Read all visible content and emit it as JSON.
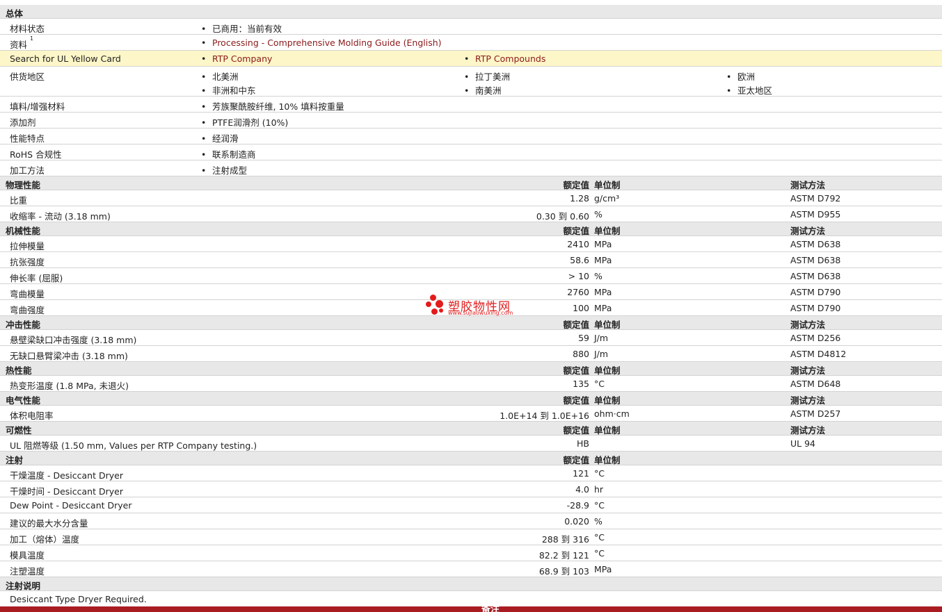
{
  "general": {
    "title": "总体",
    "status_label": "材料状态",
    "status_value": "已商用：当前有效",
    "resources_label": "资料",
    "resources_sup": "1",
    "resources_link": "Processing - Comprehensive Molding Guide (English)",
    "ul_label": "Search for UL Yellow Card",
    "ul_link1": "RTP Company",
    "ul_link2": "RTP Compounds",
    "region_label": "供货地区",
    "regions": [
      "北美洲",
      "拉丁美洲",
      "欧洲",
      "非洲和中东",
      "南美洲",
      "亚太地区"
    ],
    "filler_label": "填料/增强材料",
    "filler_value": "芳族聚酰胺纤维, 10% 填料按重量",
    "additive_label": "添加剂",
    "additive_value": "PTFE润滑剂 (10%)",
    "features_label": "性能特点",
    "features_value": "经润滑",
    "rohs_label": "RoHS 合规性",
    "rohs_value": "联系制造商",
    "process_label": "加工方法",
    "process_value": "注射成型",
    "bullet": "•"
  },
  "col_headers": {
    "value": "额定值",
    "unit": "单位制",
    "test": "测试方法"
  },
  "physical": {
    "title": "物理性能",
    "rows": [
      {
        "label": "比重",
        "value": "1.28",
        "unit": "g/cm³",
        "test": "ASTM D792"
      },
      {
        "label": "收缩率  - 流动  (3.18 mm)",
        "value": "0.30 到  0.60",
        "unit": "%",
        "test": "ASTM D955"
      }
    ]
  },
  "mechanical": {
    "title": "机械性能",
    "rows": [
      {
        "label": "拉伸模量",
        "value": "2410",
        "unit": "MPa",
        "test": "ASTM D638"
      },
      {
        "label": "抗张强度",
        "value": "58.6",
        "unit": "MPa",
        "test": "ASTM D638"
      },
      {
        "label": "伸长率  (屈服)",
        "value": "> 10",
        "unit": "%",
        "test": "ASTM D638"
      },
      {
        "label": "弯曲模量",
        "value": "2760",
        "unit": "MPa",
        "test": "ASTM D790"
      },
      {
        "label": "弯曲强度",
        "value": "100",
        "unit": "MPa",
        "test": "ASTM D790"
      }
    ]
  },
  "impact": {
    "title": "冲击性能",
    "rows": [
      {
        "label": "悬壁梁缺口冲击强度  (3.18 mm)",
        "value": "59",
        "unit": "J/m",
        "test": "ASTM D256"
      },
      {
        "label": "无缺口悬臂梁冲击  (3.18 mm)",
        "value": "880",
        "unit": "J/m",
        "test": "ASTM D4812"
      }
    ]
  },
  "thermal": {
    "title": "热性能",
    "rows": [
      {
        "label": "热变形温度  (1.8 MPa, 未退火)",
        "value": "135",
        "unit": "°C",
        "test": "ASTM D648"
      }
    ]
  },
  "electrical": {
    "title": "电气性能",
    "rows": [
      {
        "label": "体积电阻率",
        "value": "1.0E+14 到  1.0E+16",
        "unit": "ohm·cm",
        "test": "ASTM D257"
      }
    ]
  },
  "flammability": {
    "title": "可燃性",
    "rows": [
      {
        "label": "UL 阻燃等级  (1.50 mm, Values per RTP Company testing.)",
        "value": "HB",
        "unit": "",
        "test": "UL 94"
      }
    ]
  },
  "injection": {
    "title": "注射",
    "rows": [
      {
        "label": "干燥温度  - Desiccant Dryer",
        "value": "121",
        "unit": "°C"
      },
      {
        "label": "干燥时间  - Desiccant Dryer",
        "value": "4.0",
        "unit": "hr"
      },
      {
        "label": "Dew Point - Desiccant Dryer",
        "value": "-28.9",
        "unit": "°C"
      },
      {
        "label": "建议的最大水分含量",
        "value": "0.020",
        "unit": "%"
      },
      {
        "label": "加工（熔体）温度",
        "value": "288 到  316",
        "unit": "°C"
      },
      {
        "label": "模具温度",
        "value": "82.2 到  121",
        "unit": "°C"
      },
      {
        "label": "注塑温度",
        "value": "68.9 到  103",
        "unit": "MPa"
      }
    ]
  },
  "injection_notes": {
    "title": "注射说明",
    "text": "Desiccant Type Dryer Required."
  },
  "watermark": {
    "text": "塑胶物性网",
    "url": "www.sujiaowuxing.com"
  },
  "footer": {
    "text": "备注"
  },
  "colors": {
    "link": "#8b1a1a",
    "header_bg": "#e8e8e8",
    "highlight_bg": "#fdf6c8",
    "footer_bg": "#a81c22",
    "watermark": "#e31b1b"
  }
}
